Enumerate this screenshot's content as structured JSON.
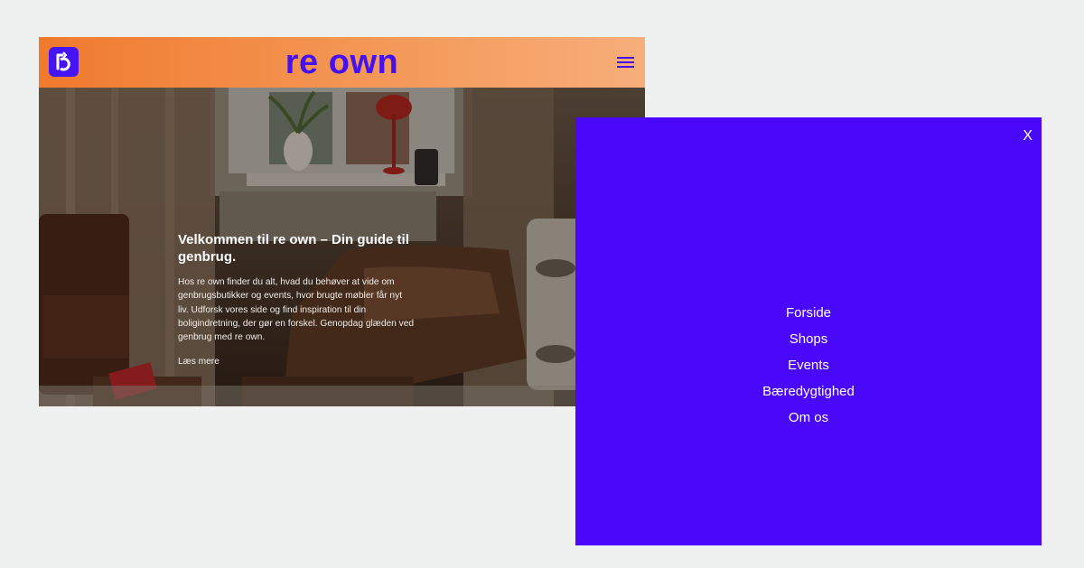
{
  "header": {
    "brand": "re own",
    "logo_icon": "recycle-r-logo",
    "menu_icon": "hamburger-icon"
  },
  "hero": {
    "title": "Velkommen til re own – Din guide til genbrug.",
    "body": "Hos re own finder du alt, hvad du behøver at vide om genbrugsbutikker og events, hvor brugte møbler får nyt liv. Udforsk vores side og find inspiration til din boligindretning, der gør en forskel. Genopdag glæden ved genbrug med re own.",
    "cta": "Læs mere"
  },
  "menu": {
    "close_label": "X",
    "items": [
      "Forside",
      "Shops",
      "Events",
      "Bæredygtighed",
      "Om os"
    ]
  },
  "colors": {
    "brand_purple": "#4511f0",
    "menu_bg": "#4a08fb",
    "header_orange": "#f07a2e",
    "page_bg": "#eff0f0"
  }
}
